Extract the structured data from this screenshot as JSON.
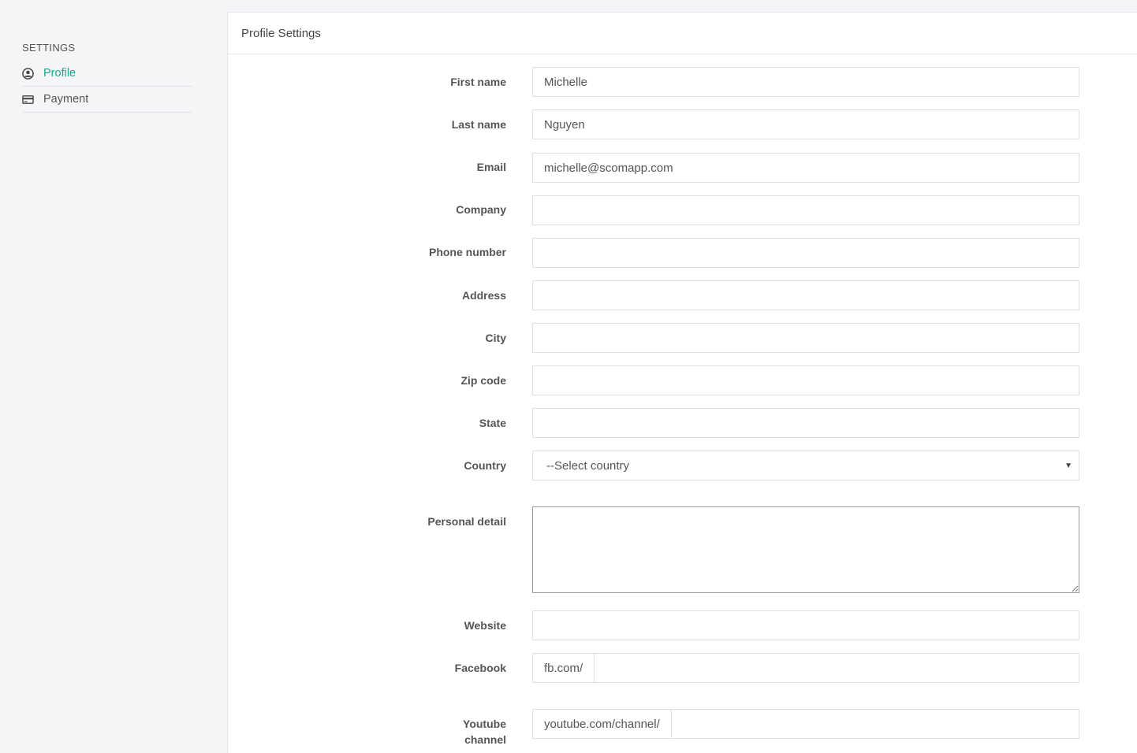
{
  "sidebar": {
    "heading": "SETTINGS",
    "items": [
      {
        "label": "Profile",
        "icon": "user-circle-icon",
        "active": true
      },
      {
        "label": "Payment",
        "icon": "credit-card-icon",
        "active": false
      }
    ]
  },
  "main": {
    "title": "Profile Settings"
  },
  "form": {
    "first_name": {
      "label": "First name",
      "value": "Michelle"
    },
    "last_name": {
      "label": "Last name",
      "value": "Nguyen"
    },
    "email": {
      "label": "Email",
      "value": "michelle@scomapp.com"
    },
    "company": {
      "label": "Company",
      "value": ""
    },
    "phone": {
      "label": "Phone number",
      "value": ""
    },
    "address": {
      "label": "Address",
      "value": ""
    },
    "city": {
      "label": "City",
      "value": ""
    },
    "zip": {
      "label": "Zip code",
      "value": ""
    },
    "state": {
      "label": "State",
      "value": ""
    },
    "country": {
      "label": "Country",
      "selected": "--Select country"
    },
    "personal_detail": {
      "label": "Personal detail",
      "value": ""
    },
    "website": {
      "label": "Website",
      "value": ""
    },
    "facebook": {
      "label": "Facebook",
      "prefix": "fb.com/",
      "value": ""
    },
    "youtube": {
      "label_line1": "Youtube",
      "label_line2": "channel",
      "prefix": "youtube.com/channel/",
      "value": ""
    }
  },
  "colors": {
    "accent": "#1aa88a",
    "background": "#f4f5f7",
    "border": "#dcdfe3"
  }
}
